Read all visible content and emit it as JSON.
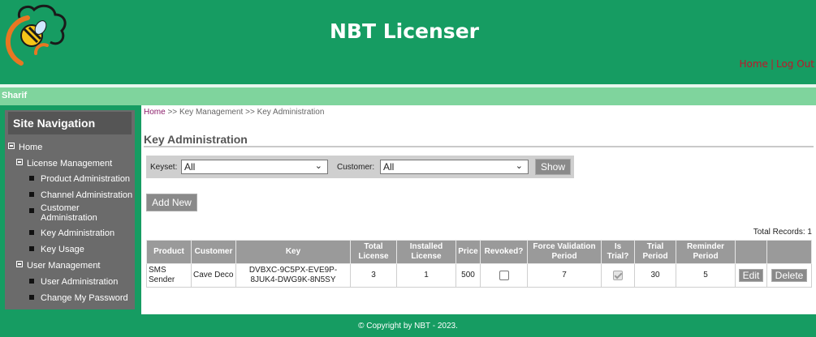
{
  "header": {
    "app_title": "NBT Licenser",
    "links": {
      "home": "Home",
      "separator": "|",
      "logout": "Log Out"
    }
  },
  "userbar": {
    "username": "Sharif"
  },
  "sidebar": {
    "title": "Site Navigation",
    "items": [
      {
        "label": "Home",
        "level": 0
      },
      {
        "label": "License Management",
        "level": 1
      },
      {
        "label": "Product Administration",
        "level": 2
      },
      {
        "label": "Channel Administration",
        "level": 2
      },
      {
        "label": "Customer Administration",
        "level": 2
      },
      {
        "label": "Key Administration",
        "level": 2
      },
      {
        "label": "Key Usage",
        "level": 2
      },
      {
        "label": "User Management",
        "level": 1
      },
      {
        "label": "User Administration",
        "level": 2
      },
      {
        "label": "Change My Password",
        "level": 2
      }
    ]
  },
  "breadcrumb": {
    "home": "Home",
    "sep1": ">>",
    "level1": "Key Management",
    "sep2": ">>",
    "level2": "Key Administration"
  },
  "page": {
    "title": "Key Administration"
  },
  "filters": {
    "keyset_label": "Keyset:",
    "keyset_value": "All",
    "customer_label": "Customer:",
    "customer_value": "All",
    "show_label": "Show"
  },
  "actions": {
    "add_new": "Add New"
  },
  "table": {
    "total_records": "Total Records: 1",
    "columns": [
      "Product",
      "Customer",
      "Key",
      "Total License",
      "Installed License",
      "Price",
      "Revoked?",
      "Force Validation Period",
      "Is Trial?",
      "Trial Period",
      "Reminder Period",
      "",
      ""
    ],
    "rows": [
      {
        "product": "SMS Sender",
        "customer": "Cave Deco",
        "key": "DVBXC-9C5PX-EVE9P-8JUK4-DWG9K-8N5SY",
        "total_license": "3",
        "installed_license": "1",
        "price": "500",
        "revoked": false,
        "force_validation_period": "7",
        "is_trial": true,
        "trial_period": "30",
        "reminder_period": "5",
        "edit_label": "Edit",
        "delete_label": "Delete"
      }
    ]
  },
  "footer": {
    "copyright": "© Copyright by NBT - 2023."
  },
  "colors": {
    "brand_green": "#169c62",
    "light_green": "#7fd49d",
    "sidebar_gray": "#6b6b6b",
    "button_gray": "#8a8a8a",
    "link_red": "#c0152a"
  }
}
